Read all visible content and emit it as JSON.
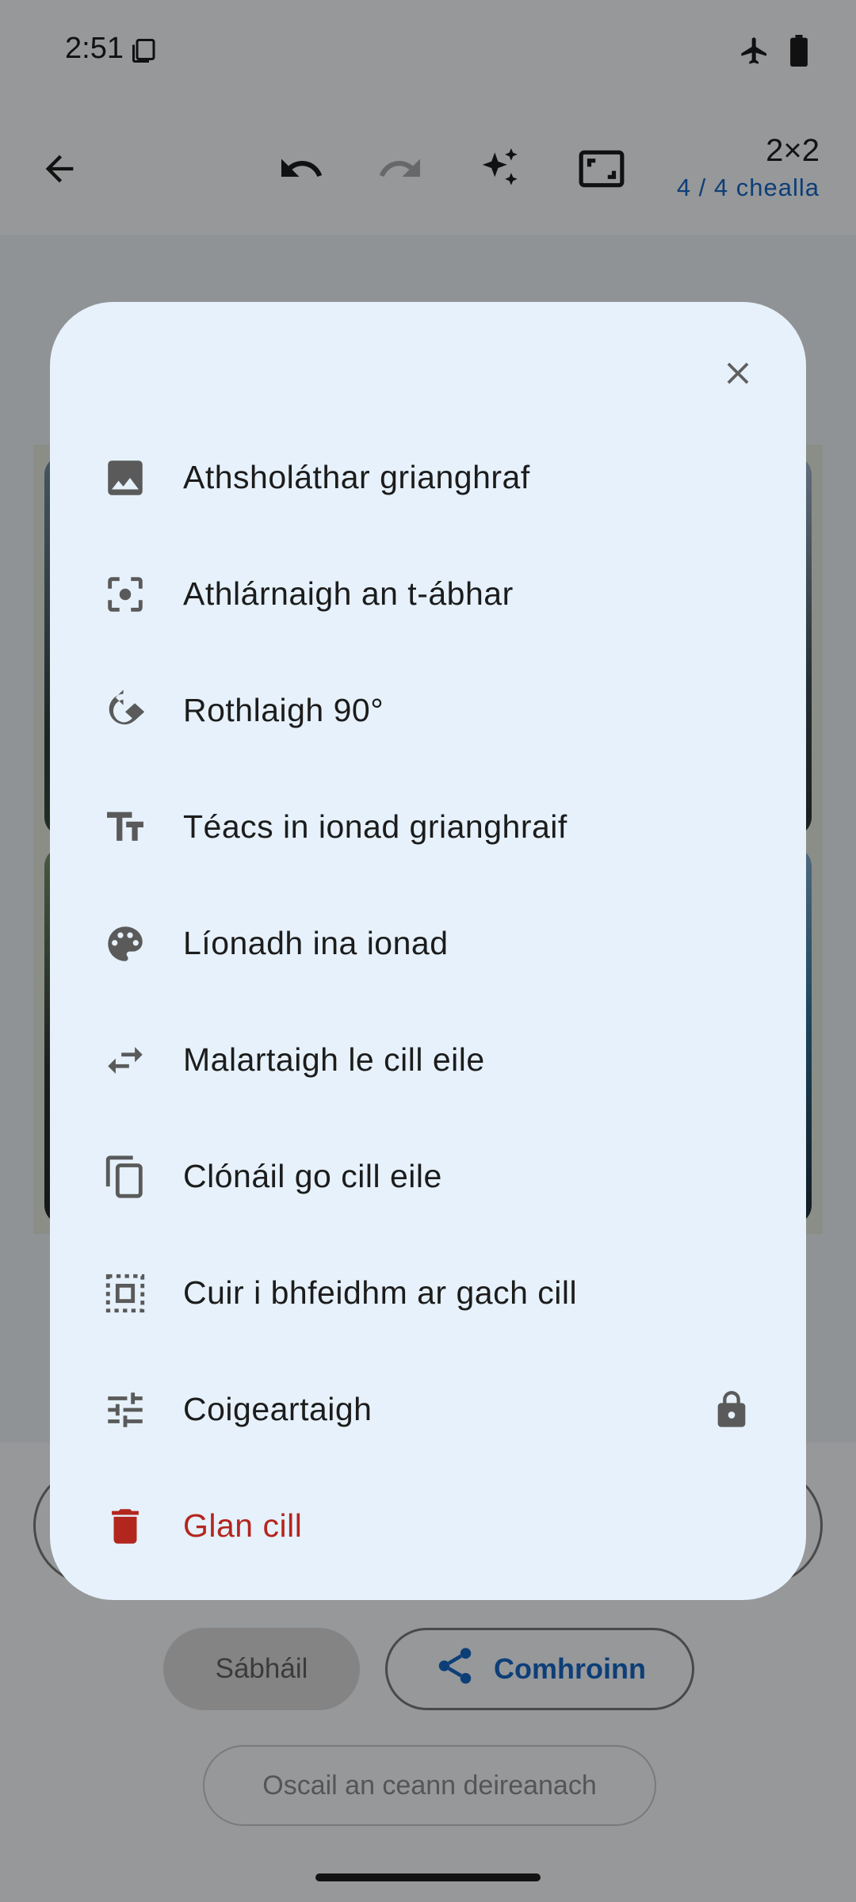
{
  "status_bar": {
    "time": "2:51"
  },
  "app_bar": {
    "grid_size": "2×2",
    "cell_count": "4 / 4 chealla"
  },
  "actions": {
    "save_label": "Sábháil",
    "share_label": "Comhroinn",
    "open_last_label": "Oscail an ceann deireanach"
  },
  "dialog": {
    "items": [
      {
        "label": "Athsholáthar grianghraf",
        "icon": "image-icon"
      },
      {
        "label": "Athlárnaigh an t-ábhar",
        "icon": "center-focus-icon"
      },
      {
        "label": "Rothlaigh 90°",
        "icon": "rotate-icon"
      },
      {
        "label": "Téacs in ionad grianghraif",
        "icon": "text-fields-icon"
      },
      {
        "label": "Líonadh ina ionad",
        "icon": "palette-icon"
      },
      {
        "label": "Malartaigh le cill eile",
        "icon": "swap-icon"
      },
      {
        "label": "Clónáil go cill eile",
        "icon": "copy-icon"
      },
      {
        "label": "Cuir i bhfeidhm ar gach cill",
        "icon": "select-all-icon"
      },
      {
        "label": "Coigeartaigh",
        "icon": "tune-icon",
        "locked": true
      },
      {
        "label": "Glan cill",
        "icon": "delete-icon",
        "danger": true
      }
    ]
  },
  "colors": {
    "accent": "#1565c0",
    "danger": "#b3261e",
    "dialog_bg": "#e6f1fb"
  }
}
